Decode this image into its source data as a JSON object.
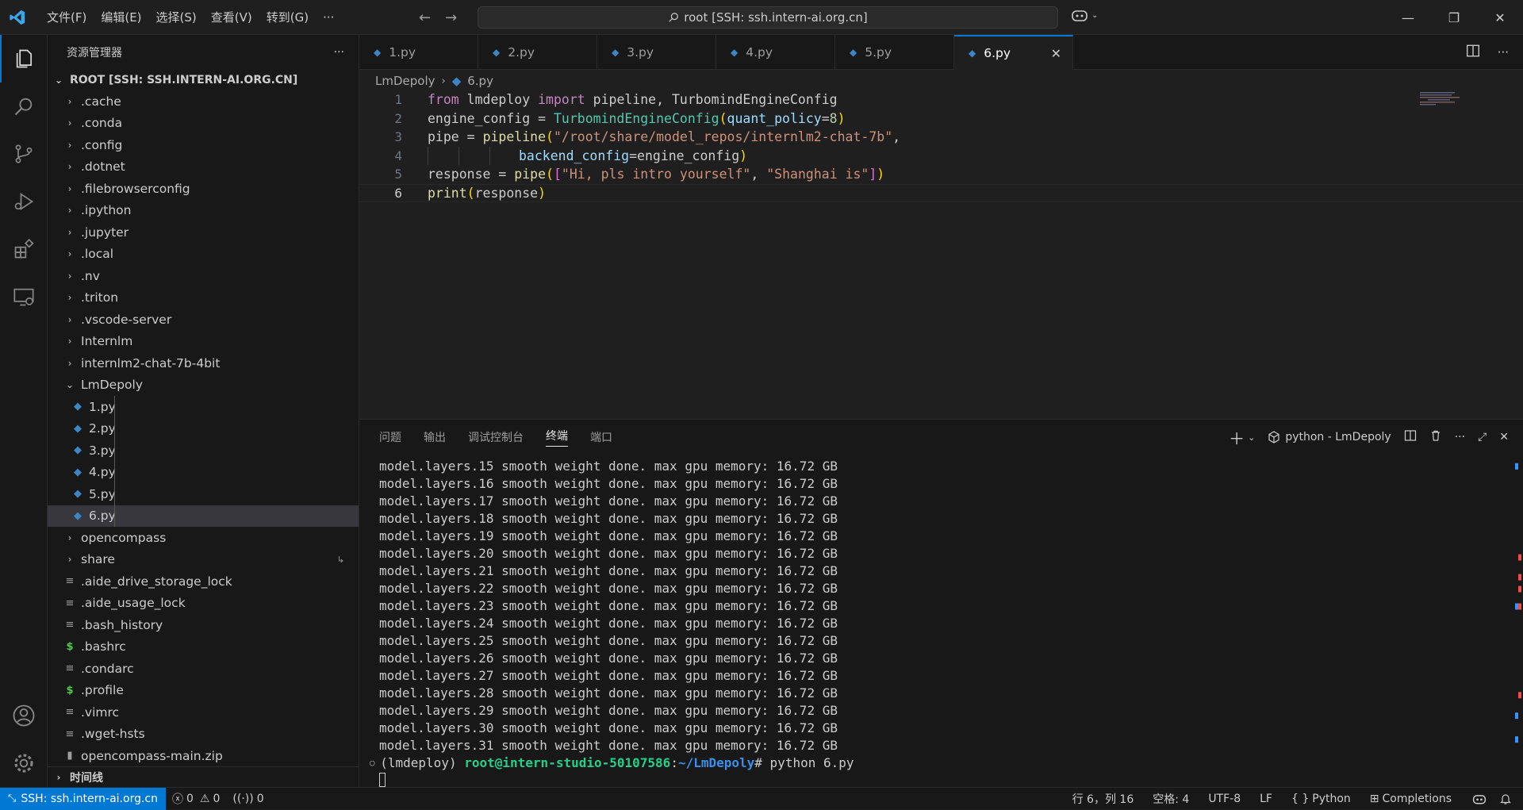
{
  "titlebar": {
    "menu": [
      "文件(F)",
      "编辑(E)",
      "选择(S)",
      "查看(V)",
      "转到(G)",
      "···"
    ],
    "search_text": "root [SSH: ssh.intern-ai.org.cn]"
  },
  "sidebar": {
    "title": "资源管理器",
    "more": "···",
    "root_label": "ROOT [SSH: SSH.INTERN-AI.ORG.CN]",
    "folders_top": [
      ".cache",
      ".conda",
      ".config",
      ".dotnet",
      ".filebrowserconfig",
      ".ipython",
      ".jupyter",
      ".local",
      ".nv",
      ".triton",
      ".vscode-server",
      "Internlm",
      "internlm2-chat-7b-4bit"
    ],
    "open_folder": "LmDepoly",
    "py_files": [
      "1.py",
      "2.py",
      "3.py",
      "4.py",
      "5.py",
      "6.py"
    ],
    "folders_bottom": [
      "opencompass",
      "share"
    ],
    "files": [
      {
        "name": ".aide_drive_storage_lock",
        "icon": "lines-icon"
      },
      {
        "name": ".aide_usage_lock",
        "icon": "lines-icon"
      },
      {
        "name": ".bash_history",
        "icon": "lines-icon"
      },
      {
        "name": ".bashrc",
        "icon": "dollar-icon"
      },
      {
        "name": ".condarc",
        "icon": "lines-icon"
      },
      {
        "name": ".profile",
        "icon": "dollar-icon"
      },
      {
        "name": ".vimrc",
        "icon": "lines-icon"
      },
      {
        "name": ".wget-hsts",
        "icon": "lines-icon"
      },
      {
        "name": "opencompass-main.zip",
        "icon": "zip-icon"
      }
    ],
    "timeline": "时间线"
  },
  "tabs": [
    "1.py",
    "2.py",
    "3.py",
    "4.py",
    "5.py",
    "6.py"
  ],
  "breadcrumb": {
    "folder": "LmDepoly",
    "file": "6.py"
  },
  "code_line_numbers": [
    "1",
    "2",
    "3",
    "4",
    "5",
    "6"
  ],
  "code": {
    "l1": {
      "a": "from",
      "b": " lmdeploy ",
      "c": "import",
      "d": " pipeline, TurbomindEngineConfig"
    },
    "l2": {
      "a": "engine_config",
      "b": " = ",
      "c": "TurbomindEngineConfig",
      "d": "(",
      "e": "quant_policy",
      "f": "=",
      "g": "8",
      "h": ")"
    },
    "l3": {
      "a": "pipe",
      "b": " = ",
      "c": "pipeline",
      "d": "(",
      "e": "\"/root/share/model_repos/internlm2-chat-7b\"",
      "f": ","
    },
    "l4": {
      "a": "backend_config",
      "b": "=engine_config",
      "c": ")"
    },
    "l5": {
      "a": "response",
      "b": " = ",
      "c": "pipe",
      "d": "(",
      "e": "[",
      "f": "\"Hi, pls intro yourself\"",
      "g": ", ",
      "h": "\"Shanghai is\"",
      "i": "]",
      "j": ")"
    },
    "l6": {
      "a": "print",
      "b": "(",
      "c": "response",
      "d": ")"
    }
  },
  "panel": {
    "tabs": [
      "问题",
      "输出",
      "调试控制台",
      "终端",
      "端口"
    ],
    "active_tab": "终端",
    "terminal_name": "python - LmDepoly",
    "lines": [
      "model.layers.15 smooth weight done. max gpu memory: 16.72 GB",
      "model.layers.16 smooth weight done. max gpu memory: 16.72 GB",
      "model.layers.17 smooth weight done. max gpu memory: 16.72 GB",
      "model.layers.18 smooth weight done. max gpu memory: 16.72 GB",
      "model.layers.19 smooth weight done. max gpu memory: 16.72 GB",
      "model.layers.20 smooth weight done. max gpu memory: 16.72 GB",
      "model.layers.21 smooth weight done. max gpu memory: 16.72 GB",
      "model.layers.22 smooth weight done. max gpu memory: 16.72 GB",
      "model.layers.23 smooth weight done. max gpu memory: 16.72 GB",
      "model.layers.24 smooth weight done. max gpu memory: 16.72 GB",
      "model.layers.25 smooth weight done. max gpu memory: 16.72 GB",
      "model.layers.26 smooth weight done. max gpu memory: 16.72 GB",
      "model.layers.27 smooth weight done. max gpu memory: 16.72 GB",
      "model.layers.28 smooth weight done. max gpu memory: 16.72 GB",
      "model.layers.29 smooth weight done. max gpu memory: 16.72 GB",
      "model.layers.30 smooth weight done. max gpu memory: 16.72 GB",
      "model.layers.31 smooth weight done. max gpu memory: 16.72 GB"
    ],
    "prompt": {
      "env": "(lmdeploy) ",
      "user": "root@intern-studio-50107586",
      "sep": ":",
      "path": "~/LmDepoly",
      "cmd": "# python 6.py"
    }
  },
  "statusbar": {
    "remote": "SSH: ssh.intern-ai.org.cn",
    "errors": "0",
    "warnings": "0",
    "ports": "0",
    "position": "行 6，列 16",
    "spaces": "空格: 4",
    "encoding": "UTF-8",
    "eol": "LF",
    "language": "Python",
    "completions": "Completions"
  },
  "colors": {
    "accent": "#0078d4",
    "background": "#1f1f1f",
    "sidebar": "#181818",
    "python_icon": "#3c85c6"
  }
}
